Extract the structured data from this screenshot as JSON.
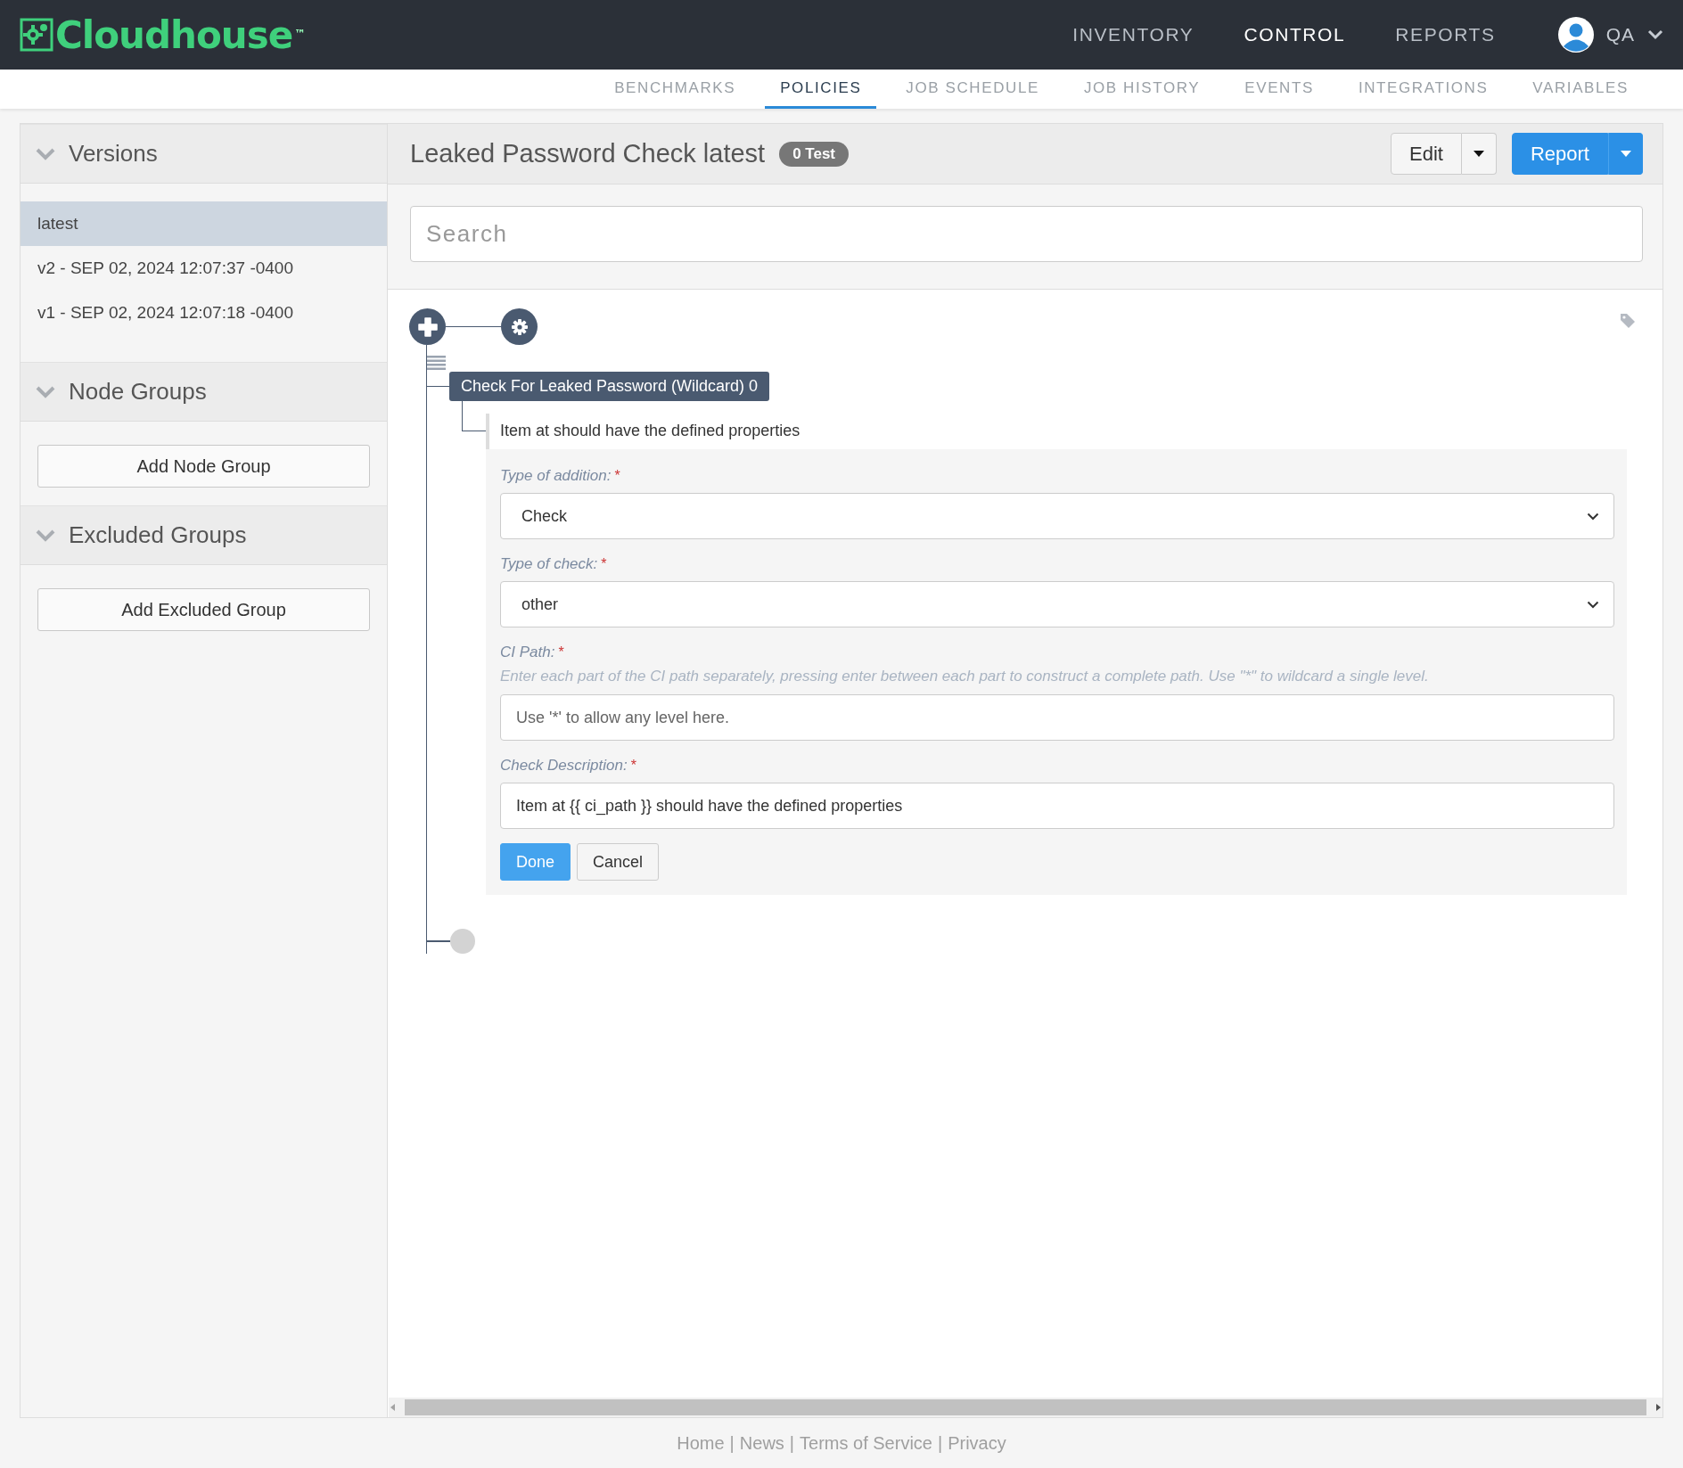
{
  "brand": {
    "name": "Cloudhouse",
    "mark": "™"
  },
  "main_nav": [
    {
      "label": "INVENTORY",
      "selected": false
    },
    {
      "label": "CONTROL",
      "selected": true
    },
    {
      "label": "REPORTS",
      "selected": false
    }
  ],
  "user": {
    "name": "QA"
  },
  "sub_nav": [
    {
      "label": "BENCHMARKS",
      "selected": false
    },
    {
      "label": "POLICIES",
      "selected": true
    },
    {
      "label": "JOB SCHEDULE",
      "selected": false
    },
    {
      "label": "JOB HISTORY",
      "selected": false
    },
    {
      "label": "EVENTS",
      "selected": false
    },
    {
      "label": "INTEGRATIONS",
      "selected": false
    },
    {
      "label": "VARIABLES",
      "selected": false
    }
  ],
  "sidebar": {
    "sections": [
      {
        "kind": "list",
        "title": "Versions",
        "items": [
          {
            "label": "latest",
            "selected": true
          },
          {
            "label": "v2 - SEP 02, 2024 12:07:37 -0400",
            "selected": false
          },
          {
            "label": "v1 - SEP 02, 2024 12:07:18 -0400",
            "selected": false
          }
        ]
      },
      {
        "kind": "button",
        "title": "Node Groups",
        "button": "Add Node Group"
      },
      {
        "kind": "button",
        "title": "Excluded Groups",
        "button": "Add Excluded Group"
      }
    ]
  },
  "policy": {
    "title": "Leaked Password Check latest",
    "badge": "0 Test",
    "edit_button": "Edit",
    "report_button": "Report",
    "search": {
      "placeholder": "Search"
    }
  },
  "tree": {
    "label": "Check For Leaked Password (Wildcard) 0",
    "children": [
      {
        "label": "Item at should have the defined properties"
      }
    ]
  },
  "form": {
    "fields": [
      {
        "kind": "select",
        "label": "Type of addition:",
        "required_mark": "*",
        "value": "Check"
      },
      {
        "kind": "select",
        "label": "Type of check:",
        "required_mark": "*",
        "value": "other"
      },
      {
        "kind": "text",
        "label": "CI Path:",
        "required_mark": "*",
        "hint": "Enter each part of the CI path separately, pressing enter between each part to construct a complete path. Use \"*\" to wildcard a single level.",
        "placeholder": "Use '*' to allow any level here."
      },
      {
        "kind": "text",
        "label": "Check Description:",
        "required_mark": "*",
        "value": "Item at {{ ci_path }} should have the defined properties"
      }
    ],
    "buttons": [
      {
        "label": "Done",
        "kind": "primary"
      },
      {
        "label": "Cancel",
        "kind": "default"
      }
    ]
  },
  "footer": {
    "links": [
      "Home",
      "News",
      "Terms of Service",
      "Privacy"
    ],
    "separator": "|"
  }
}
